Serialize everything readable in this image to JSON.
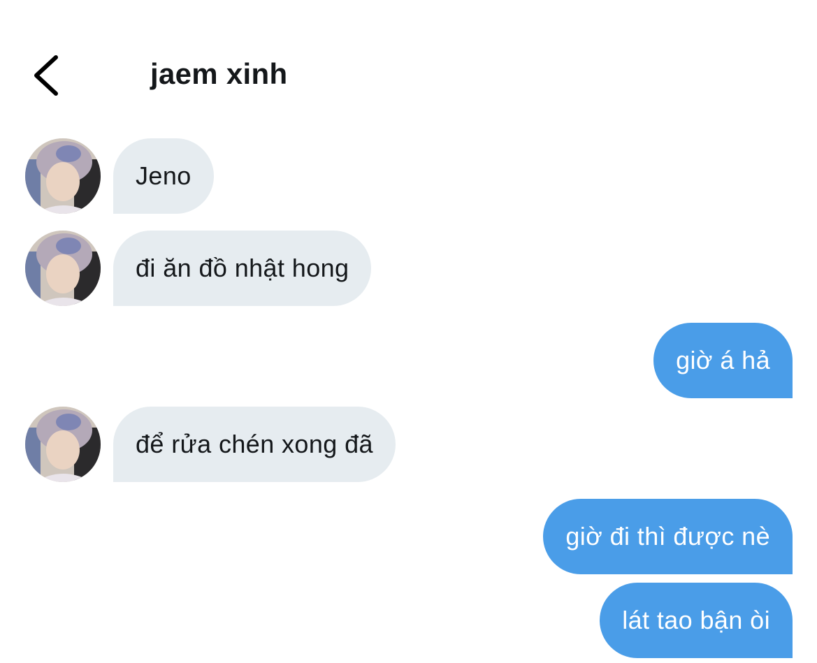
{
  "header": {
    "title": "jaem xinh",
    "back_icon": "chevron-left-icon"
  },
  "messages": [
    {
      "direction": "incoming",
      "text": "Jeno"
    },
    {
      "direction": "incoming",
      "text": "đi ăn đồ nhật hong"
    },
    {
      "direction": "outgoing",
      "text": "giờ á hả"
    },
    {
      "direction": "incoming",
      "text": "để rửa chén xong đã"
    },
    {
      "direction": "outgoing",
      "text": "giờ đi thì được nè"
    },
    {
      "direction": "outgoing",
      "text": "lát tao bận òi"
    }
  ],
  "colors": {
    "incoming_bubble": "#e6ecf0",
    "outgoing_bubble": "#4a9de8",
    "outgoing_text": "#ffffff",
    "incoming_text": "#14171a"
  }
}
